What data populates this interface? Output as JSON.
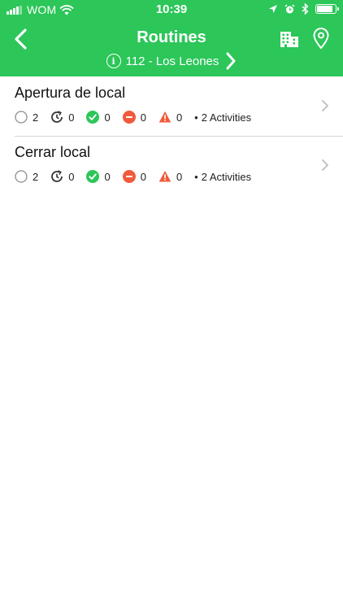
{
  "status_bar": {
    "carrier": "WOM",
    "time": "10:39",
    "battery_level": 0.9
  },
  "header": {
    "title": "Routines",
    "location": "112 - Los Leones",
    "background_color": "#2cc659"
  },
  "routines": [
    {
      "name": "Apertura de local",
      "pending": "2",
      "in_progress": "0",
      "done": "0",
      "blocked": "0",
      "warnings": "0",
      "activities": "2 Activities"
    },
    {
      "name": "Cerrar local",
      "pending": "2",
      "in_progress": "0",
      "done": "0",
      "blocked": "0",
      "warnings": "0",
      "activities": "2 Activities"
    }
  ],
  "colors": {
    "done": "#2cc659",
    "blocked": "#f05a3c",
    "warning": "#f05a3c",
    "pending": "#8e8e8e"
  }
}
